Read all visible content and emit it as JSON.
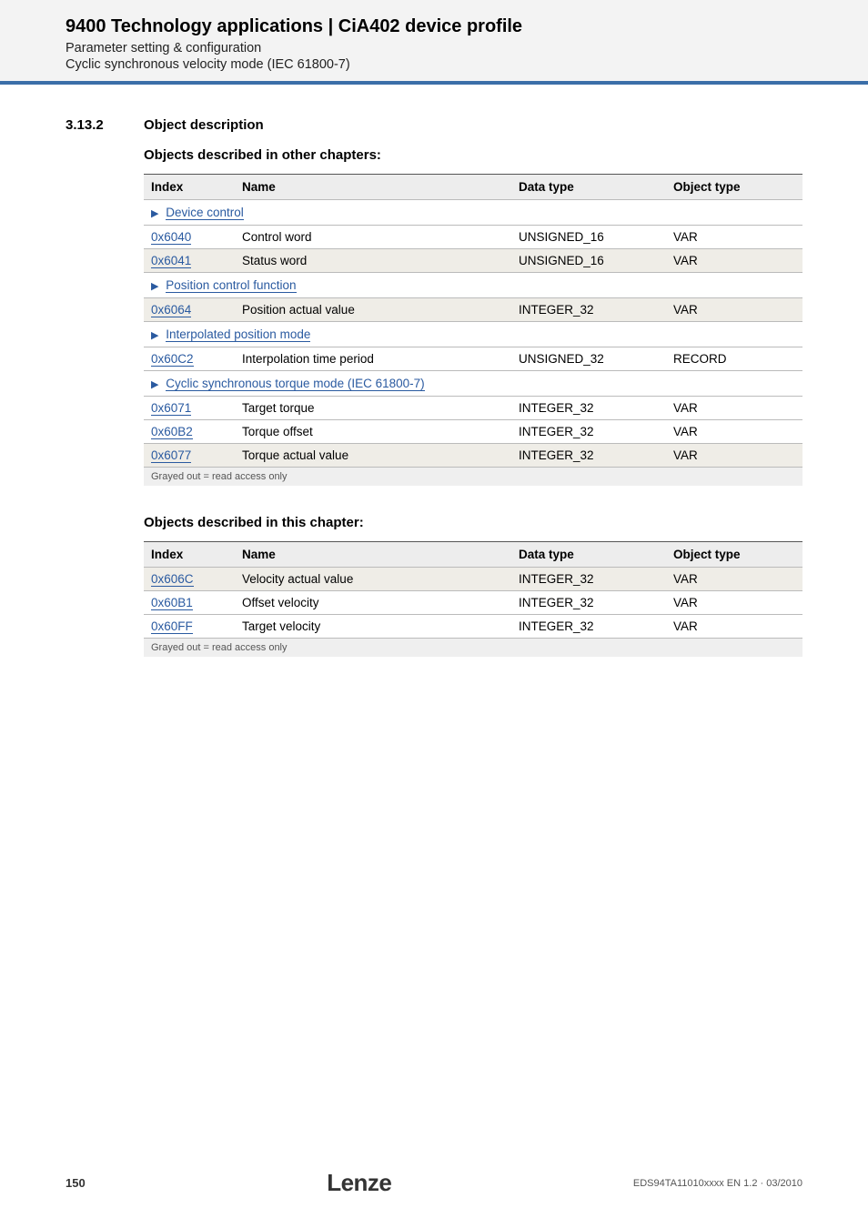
{
  "header": {
    "title": "9400 Technology applications | CiA402 device profile",
    "sub1": "Parameter setting & configuration",
    "sub2": "Cyclic synchronous velocity mode (IEC 61800-7)"
  },
  "section": {
    "number": "3.13.2",
    "title": "Object description"
  },
  "subhead1": "Objects described in other chapters:",
  "table1": {
    "headers": {
      "index": "Index",
      "name": "Name",
      "dtype": "Data type",
      "otype": "Object type"
    },
    "groups": [
      {
        "link": "Device control",
        "rows": [
          {
            "index": "0x6040",
            "name": "Control word",
            "dtype": "UNSIGNED_16",
            "otype": "VAR",
            "ro": false
          },
          {
            "index": "0x6041",
            "name": "Status word",
            "dtype": "UNSIGNED_16",
            "otype": "VAR",
            "ro": true
          }
        ]
      },
      {
        "link": "Position control function",
        "rows": [
          {
            "index": "0x6064",
            "name": "Position actual value",
            "dtype": "INTEGER_32",
            "otype": "VAR",
            "ro": true
          }
        ]
      },
      {
        "link": "Interpolated position mode",
        "rows": [
          {
            "index": "0x60C2",
            "name": "Interpolation time period",
            "dtype": "UNSIGNED_32",
            "otype": "RECORD",
            "ro": false
          }
        ]
      },
      {
        "link": "Cyclic synchronous torque mode (IEC 61800-7)",
        "rows": [
          {
            "index": "0x6071",
            "name": "Target torque",
            "dtype": "INTEGER_32",
            "otype": "VAR",
            "ro": false
          },
          {
            "index": "0x60B2",
            "name": "Torque offset",
            "dtype": "INTEGER_32",
            "otype": "VAR",
            "ro": false
          },
          {
            "index": "0x6077",
            "name": "Torque actual value",
            "dtype": "INTEGER_32",
            "otype": "VAR",
            "ro": true
          }
        ]
      }
    ],
    "footnote": "Grayed out = read access only"
  },
  "subhead2": "Objects described in this chapter:",
  "table2": {
    "headers": {
      "index": "Index",
      "name": "Name",
      "dtype": "Data type",
      "otype": "Object type"
    },
    "rows": [
      {
        "index": "0x606C",
        "name": "Velocity actual value",
        "dtype": "INTEGER_32",
        "otype": "VAR",
        "ro": true
      },
      {
        "index": "0x60B1",
        "name": "Offset velocity",
        "dtype": "INTEGER_32",
        "otype": "VAR",
        "ro": false
      },
      {
        "index": "0x60FF",
        "name": "Target velocity",
        "dtype": "INTEGER_32",
        "otype": "VAR",
        "ro": false
      }
    ],
    "footnote": "Grayed out = read access only"
  },
  "footer": {
    "page": "150",
    "logo": "Lenze",
    "docid": "EDS94TA11010xxxx EN 1.2 · 03/2010"
  }
}
